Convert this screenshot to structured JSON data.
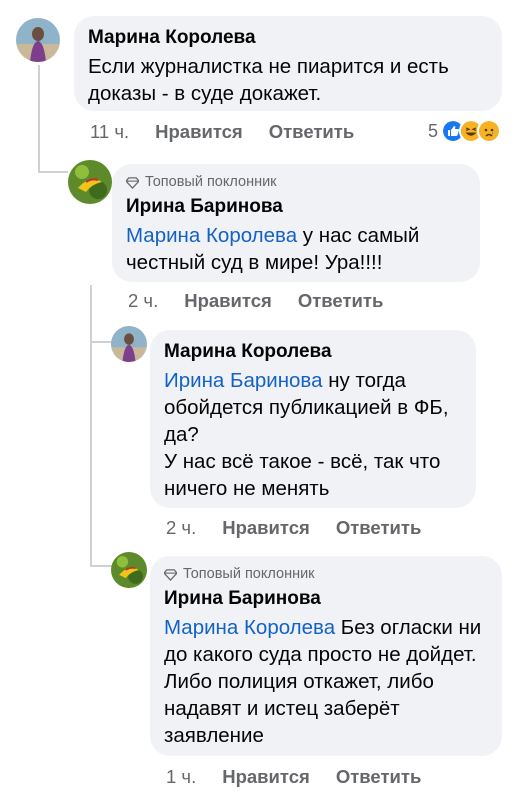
{
  "comments": [
    {
      "author": "Марина Королева",
      "text": "Если журналистка не пиарится и есть доказы - в суде докажет.",
      "time": "11 ч.",
      "like_label": "Нравится",
      "reply_label": "Ответить",
      "reactions": {
        "count": "5",
        "types": [
          "like-icon",
          "haha-icon",
          "sad-icon"
        ]
      },
      "replies": [
        {
          "badge": "Топовый поклонник",
          "author": "Ирина Баринова",
          "mention": "Марина Королева",
          "text": " у нас самый честный суд в мире! Ура!!!!",
          "time": "2 ч.",
          "like_label": "Нравится",
          "reply_label": "Ответить"
        },
        {
          "author": "Марина Королева",
          "mention": "Ирина Баринова",
          "text_line1": " ну тогда обойдется публикацией в ФБ, да?",
          "text_line2": "У нас всё такое - всё, так что ничего не менять",
          "time": "2 ч.",
          "like_label": "Нравится",
          "reply_label": "Ответить"
        },
        {
          "badge": "Топовый поклонник",
          "author": "Ирина Баринова",
          "mention": "Марина Королева",
          "text": " Без огласки ни до какого суда просто не дойдет. Либо полиция откажет, либо надавят и истец заберёт заявление",
          "time": "1 ч.",
          "like_label": "Нравится",
          "reply_label": "Ответить"
        }
      ]
    }
  ],
  "colors": {
    "mention": "#1461c8",
    "bubble": "#f0f2f5",
    "meta": "#65676b"
  }
}
